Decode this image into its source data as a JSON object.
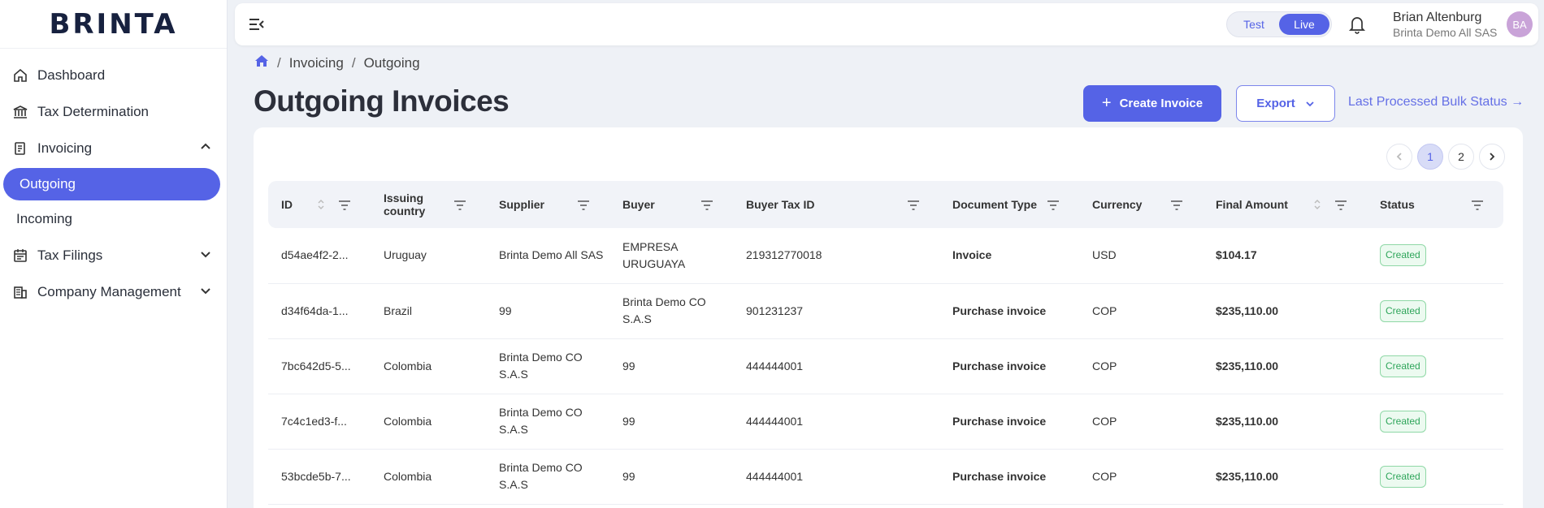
{
  "app": {
    "logo": "BRINTA"
  },
  "sidebar": {
    "items": [
      {
        "label": "Dashboard",
        "icon": "home-icon"
      },
      {
        "label": "Tax Determination",
        "icon": "bank-icon"
      },
      {
        "label": "Invoicing",
        "icon": "invoice-icon",
        "expanded": true,
        "children": [
          {
            "label": "Outgoing",
            "active": true
          },
          {
            "label": "Incoming"
          }
        ]
      },
      {
        "label": "Tax Filings",
        "icon": "calendar-icon",
        "expanded": false
      },
      {
        "label": "Company Management",
        "icon": "building-icon",
        "expanded": false
      }
    ]
  },
  "topbar": {
    "env": {
      "test": "Test",
      "live": "Live",
      "active": "Live"
    },
    "user": {
      "name": "Brian Altenburg",
      "org": "Brinta Demo All SAS",
      "initials": "BA"
    }
  },
  "breadcrumb": {
    "items": [
      "Invoicing",
      "Outgoing"
    ]
  },
  "page": {
    "title": "Outgoing Invoices",
    "create_button": "Create Invoice",
    "export_button": "Export",
    "bulk_status_link": "Last Processed Bulk Status →"
  },
  "pagination": {
    "pages": [
      "1",
      "2"
    ],
    "current": "1"
  },
  "table": {
    "columns": [
      "ID",
      "Issuing country",
      "Supplier",
      "Buyer",
      "Buyer Tax ID",
      "Document Type",
      "Currency",
      "Final Amount",
      "Status"
    ],
    "rows": [
      {
        "id": "d54ae4f2-2...",
        "country": "Uruguay",
        "supplier": "Brinta Demo All SAS",
        "buyer": "EMPRESA URUGUAYA",
        "tax_id": "219312770018",
        "doc_type": "Invoice",
        "currency": "USD",
        "amount": "$104.17",
        "status": "Created"
      },
      {
        "id": "d34f64da-1...",
        "country": "Brazil",
        "supplier": "99",
        "buyer": "Brinta Demo CO S.A.S",
        "tax_id": "901231237",
        "doc_type": "Purchase invoice",
        "currency": "COP",
        "amount": "$235,110.00",
        "status": "Created"
      },
      {
        "id": "7bc642d5-5...",
        "country": "Colombia",
        "supplier": "Brinta Demo CO S.A.S",
        "buyer": "99",
        "tax_id": "444444001",
        "doc_type": "Purchase invoice",
        "currency": "COP",
        "amount": "$235,110.00",
        "status": "Created"
      },
      {
        "id": "7c4c1ed3-f...",
        "country": "Colombia",
        "supplier": "Brinta Demo CO S.A.S",
        "buyer": "99",
        "tax_id": "444444001",
        "doc_type": "Purchase invoice",
        "currency": "COP",
        "amount": "$235,110.00",
        "status": "Created"
      },
      {
        "id": "53bcde5b-7...",
        "country": "Colombia",
        "supplier": "Brinta Demo CO S.A.S",
        "buyer": "99",
        "tax_id": "444444001",
        "doc_type": "Purchase invoice",
        "currency": "COP",
        "amount": "$235,110.00",
        "status": "Created"
      }
    ]
  },
  "colors": {
    "accent": "#5563e6",
    "status_created": "#2ea55a",
    "background": "#eef1f6"
  }
}
